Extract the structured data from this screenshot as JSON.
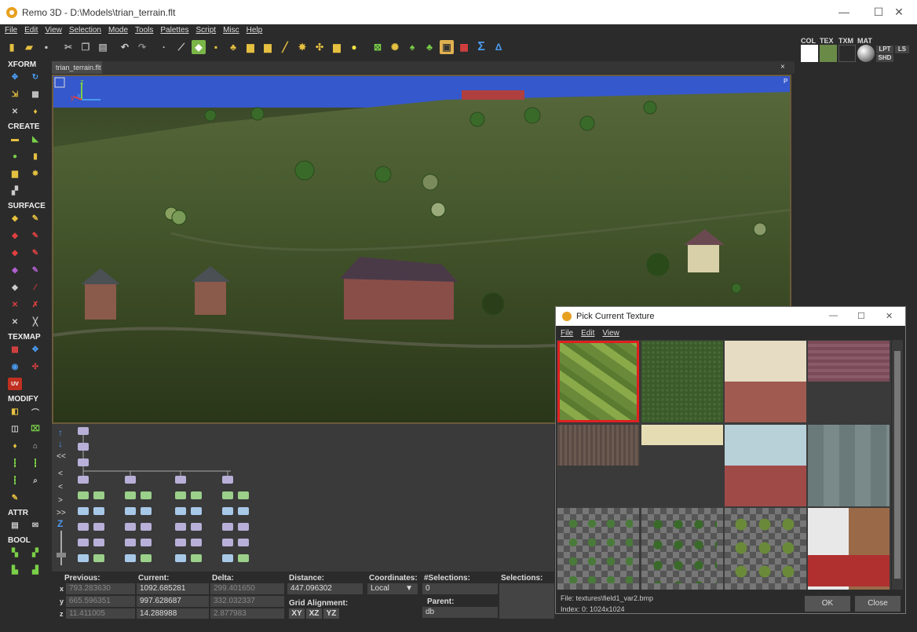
{
  "window": {
    "title": "Remo 3D - D:\\Models\\trian_terrain.flt",
    "minimize": "—",
    "maximize": "☐",
    "close": "✕"
  },
  "menu": [
    "File",
    "Edit",
    "View",
    "Selection",
    "Mode",
    "Tools",
    "Palettes",
    "Script",
    "Misc",
    "Help"
  ],
  "left_sections": {
    "xform": "XFORM",
    "create": "CREATE",
    "surface": "SURFACE",
    "texmap": "TEXMAP",
    "modify": "MODIFY",
    "attr": "ATTR",
    "bool": "BOOL"
  },
  "tab": {
    "label": "trian_terrain.flt",
    "close": "×"
  },
  "viewport": {
    "corner_label": "P",
    "axis_z": "z",
    "axis_y": "y",
    "axis_x": "x"
  },
  "tree": {
    "nav": [
      "↑",
      "↓",
      "<<",
      "<",
      "<",
      ">",
      ">>",
      "Z"
    ]
  },
  "status": {
    "previous_label": "Previous:",
    "current_label": "Current:",
    "delta_label": "Delta:",
    "distance_label": "Distance:",
    "coordinates_label": "Coordinates:",
    "selections_count_label": "#Selections:",
    "selections_label": "Selections:",
    "grid_alignment_label": "Grid Alignment:",
    "parent_label": "Parent:",
    "axes": [
      "x",
      "y",
      "z"
    ],
    "previous": [
      "793.283630",
      "665.596351",
      "11.411005"
    ],
    "current": [
      "1092.685281",
      "997.628687",
      "14.288988"
    ],
    "delta": [
      "299.401650",
      "332.032337",
      "2.877983"
    ],
    "distance": "447.096302",
    "coordinates": "Local",
    "selections_count": "0",
    "parent": "db",
    "grid_buttons": [
      "XY",
      "XZ",
      "YZ"
    ]
  },
  "right_panel": {
    "tabs": [
      "COL",
      "TEX",
      "TXM",
      "MAT"
    ],
    "lpt": "LPT",
    "ls": "LS",
    "shd": "SHD"
  },
  "dialog": {
    "title": "Pick Current Texture",
    "menu": [
      "File",
      "Edit",
      "View"
    ],
    "file_info": "File: textures\\field1_var2.bmp",
    "index_info": "Index: 0: 1024x1024",
    "ok": "OK",
    "close": "Close",
    "minimize": "—",
    "maximize": "☐",
    "x": "✕"
  },
  "colors": {
    "accent_selected": "#e02020",
    "bg": "#2b2b2b"
  }
}
